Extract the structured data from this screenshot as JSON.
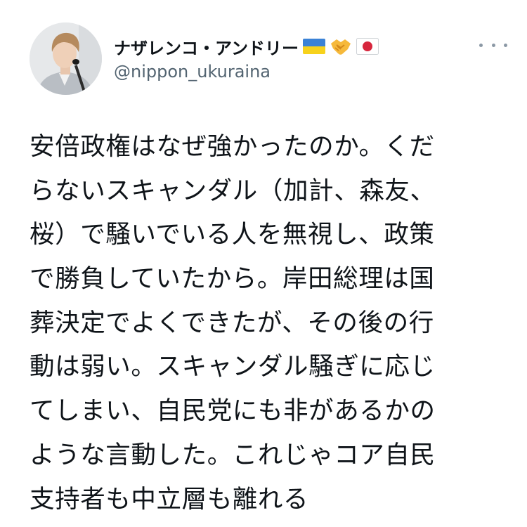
{
  "tweet": {
    "author": {
      "display_name": "ナザレンコ・アンドリー",
      "emojis": [
        "flag-ukraine-icon",
        "handshake-icon",
        "flag-japan-icon"
      ],
      "handle": "@nippon_ukuraina"
    },
    "text_lines": [
      "安倍政権はなぜ強かったのか。くだ",
      "らないスキャンダル（加計、森友、",
      "桜）で騒いでいる人を無視し、政策",
      "で勝負していたから。岸田総理は国",
      "葬決定でよくできたが、その後の行",
      "動は弱い。スキャンダル騒ぎに応じ",
      "てしまい、自民党にも非があるかの",
      "ような言動した。これじゃコア自民",
      "支持者も中立層も離れる"
    ],
    "colors": {
      "text": "#0f1419",
      "secondary": "#536471",
      "more_dots": "#8b98a5"
    }
  }
}
